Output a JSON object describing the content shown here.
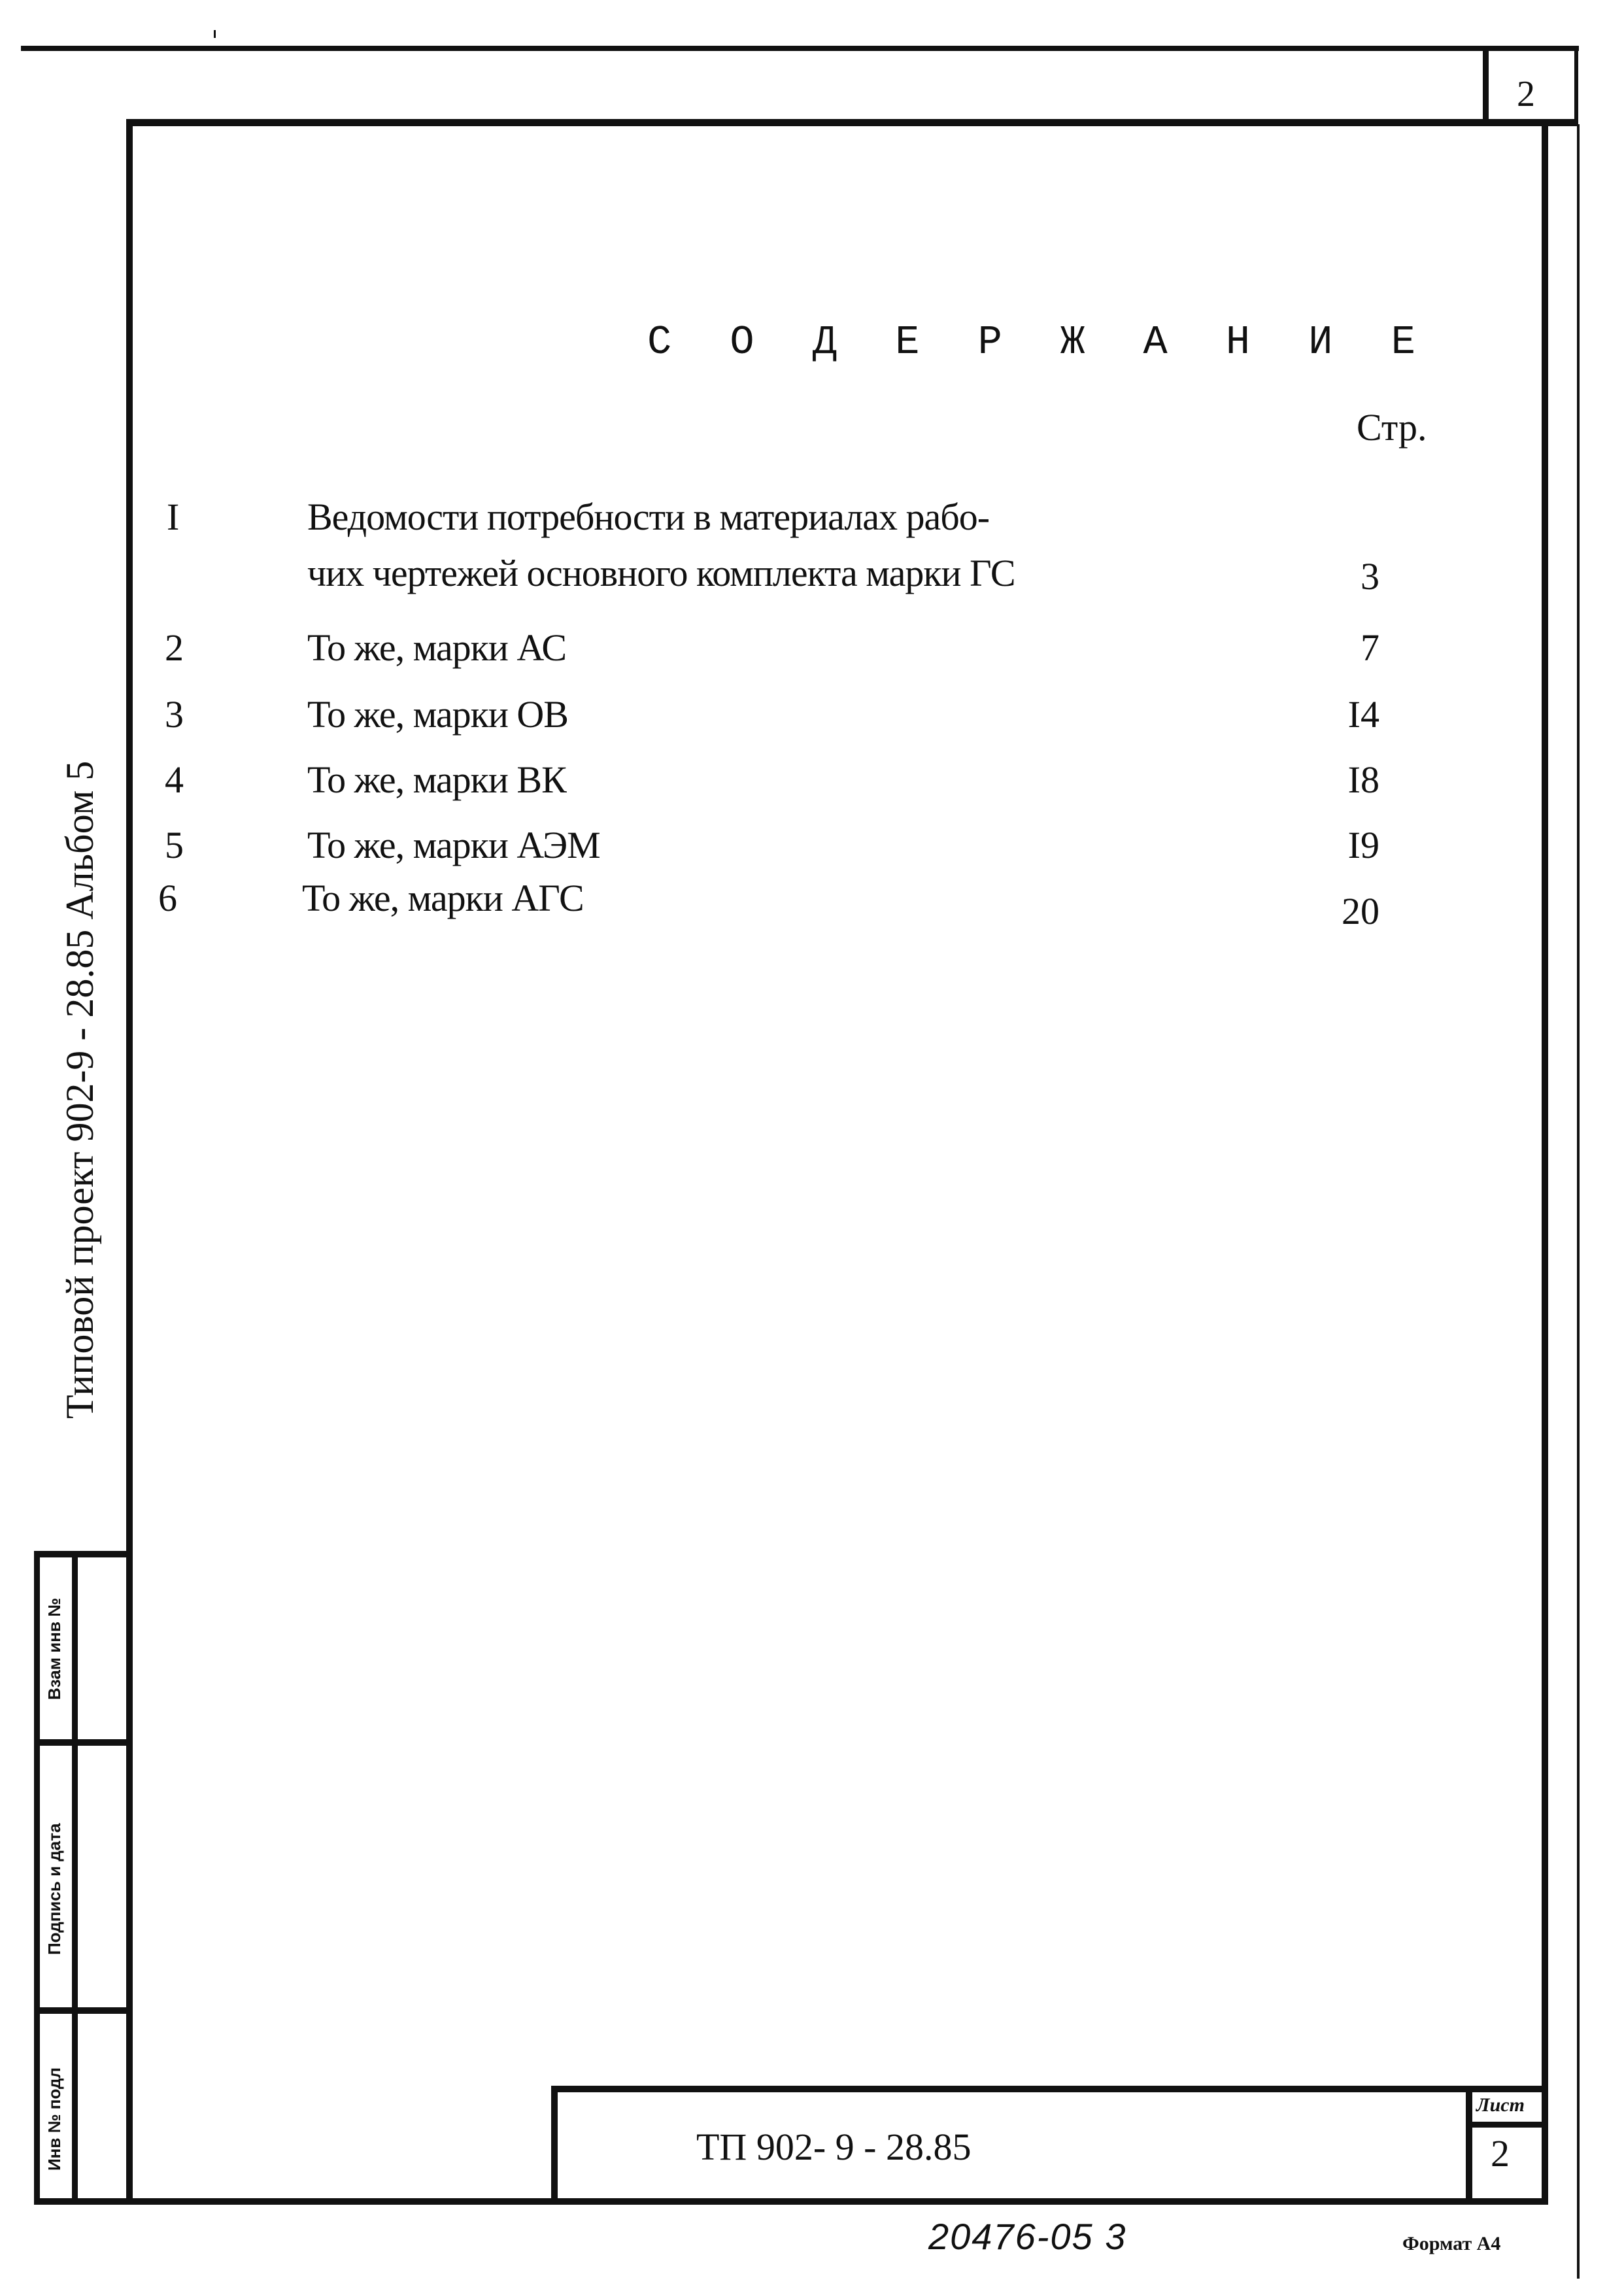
{
  "document": {
    "title": "С О Д Е Р Ж А Н И Е",
    "page_column_header": "Стр.",
    "corner_sheet_number": "2"
  },
  "toc": [
    {
      "number": "I",
      "lines": [
        "Ведомости потребности в материалах рабо-",
        "чих чертежей основного комплекта марки ГС"
      ],
      "page": "3"
    },
    {
      "number": "2",
      "lines": [
        "То же, марки  АС"
      ],
      "page": "7"
    },
    {
      "number": "3",
      "lines": [
        "То же, марки ОВ"
      ],
      "page": "I4"
    },
    {
      "number": "4",
      "lines": [
        "То же, марки ВК"
      ],
      "page": "I8"
    },
    {
      "number": "5",
      "lines": [
        "То же, марки АЭМ"
      ],
      "page": "I9"
    },
    {
      "number": "6",
      "lines": [
        "То же, марки АГС"
      ],
      "page": "20"
    }
  ],
  "side_margin": {
    "project_label": "Типовой проект 902-9 - 28.85  Альбом 5",
    "stamp_fields": [
      "Взам инв №",
      "Подпись и дата",
      "Инв № подл"
    ]
  },
  "title_block": {
    "document_code": "ТП 902- 9 - 28.85",
    "sheet_label": "Лист",
    "sheet_number": "2"
  },
  "footer": {
    "handwritten_note": "20476-05   3",
    "format_label": "Формат А4"
  }
}
